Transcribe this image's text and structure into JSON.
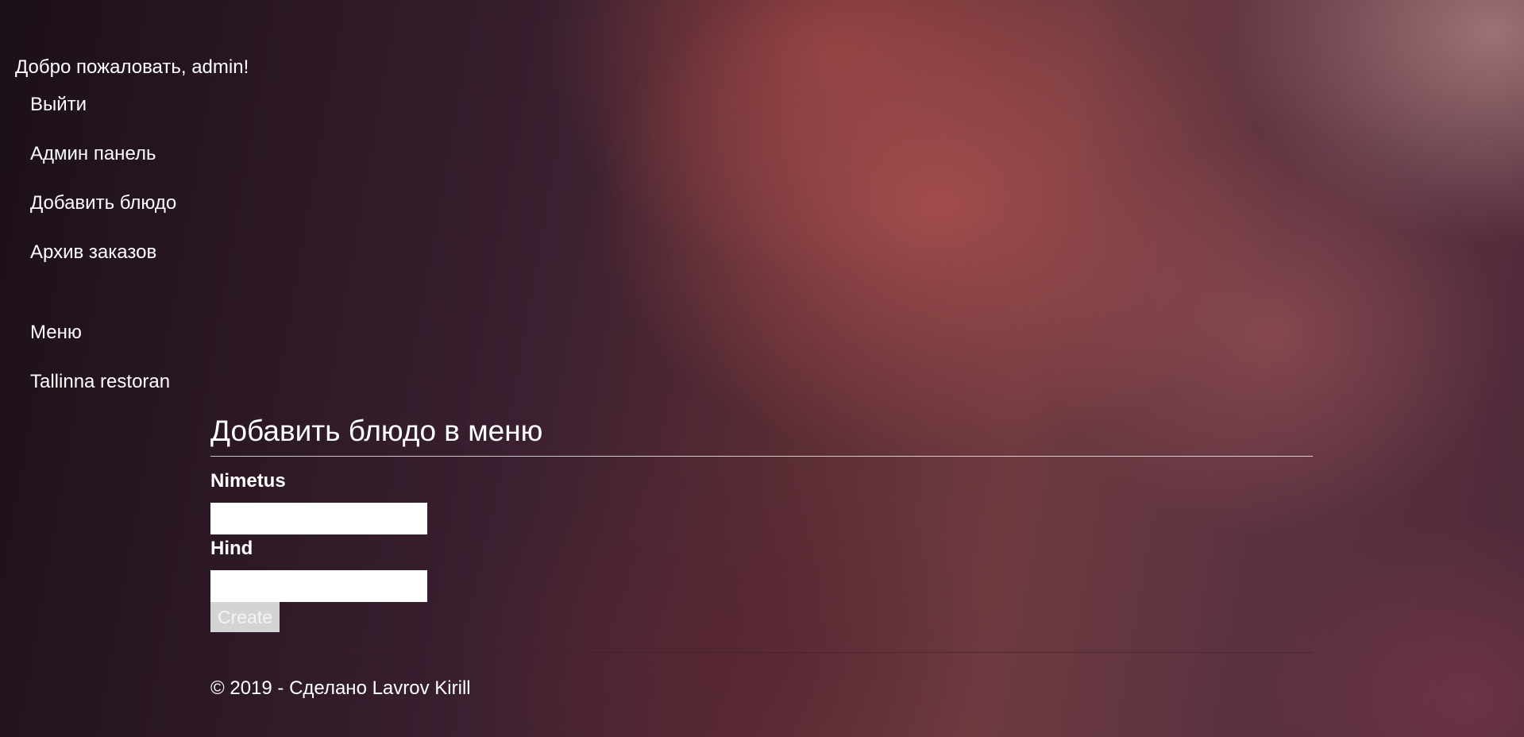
{
  "header": {
    "welcome_text": "Добро пожаловать, admin!"
  },
  "nav": {
    "admin_items": [
      {
        "label": "Выйти"
      },
      {
        "label": "Админ панель"
      },
      {
        "label": "Добавить блюдо"
      },
      {
        "label": "Архив заказов"
      }
    ],
    "site_items": [
      {
        "label": "Меню"
      },
      {
        "label": "Tallinna restoran"
      }
    ]
  },
  "main": {
    "title": "Добавить блюдо в меню",
    "fields": [
      {
        "label": "Nimetus",
        "value": "",
        "placeholder": ""
      },
      {
        "label": "Hind",
        "value": "",
        "placeholder": ""
      }
    ],
    "submit_label": "Create"
  },
  "footer": {
    "text": "© 2019 - Сделано Lavrov Kirill"
  }
}
